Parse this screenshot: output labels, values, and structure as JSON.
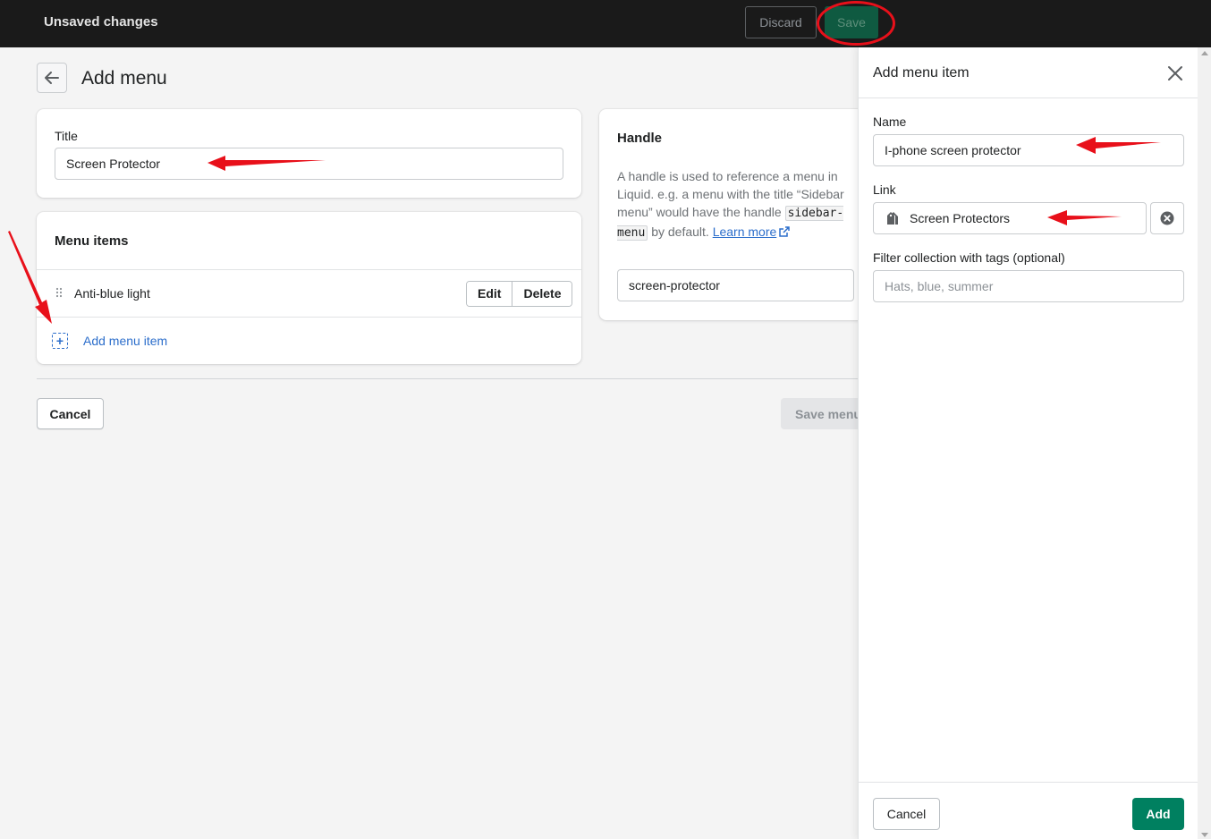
{
  "topbar": {
    "title": "Unsaved changes",
    "discard_label": "Discard",
    "save_label": "Save"
  },
  "page": {
    "title": "Add menu",
    "back_icon": "arrow-left-icon"
  },
  "title_card": {
    "label": "Title",
    "value": "Screen Protector"
  },
  "menu_items_card": {
    "heading": "Menu items",
    "items": [
      {
        "label": "Anti-blue light",
        "edit_label": "Edit",
        "delete_label": "Delete"
      }
    ],
    "add_label": "Add menu item"
  },
  "handle_card": {
    "heading": "Handle",
    "desc_before": "A handle is used to reference a menu in Liquid. e.g. a menu with the title “Sidebar menu” would have the handle",
    "desc_code": "sidebar-menu",
    "desc_after": "by default.",
    "learn_more": "Learn more",
    "value": "screen-protector"
  },
  "footer": {
    "cancel_label": "Cancel",
    "save_menu_label": "Save menu"
  },
  "panel": {
    "title": "Add menu item",
    "name_label": "Name",
    "name_value": "I-phone screen protector",
    "link_label": "Link",
    "link_value": "Screen Protectors",
    "filter_label": "Filter collection with tags (optional)",
    "filter_placeholder": "Hats, blue, summer",
    "cancel_label": "Cancel",
    "add_label": "Add"
  },
  "colors": {
    "topbar": "#1a1a1a",
    "primary": "#008060",
    "link": "#2c6ecb",
    "annotation": "#e8101a"
  }
}
